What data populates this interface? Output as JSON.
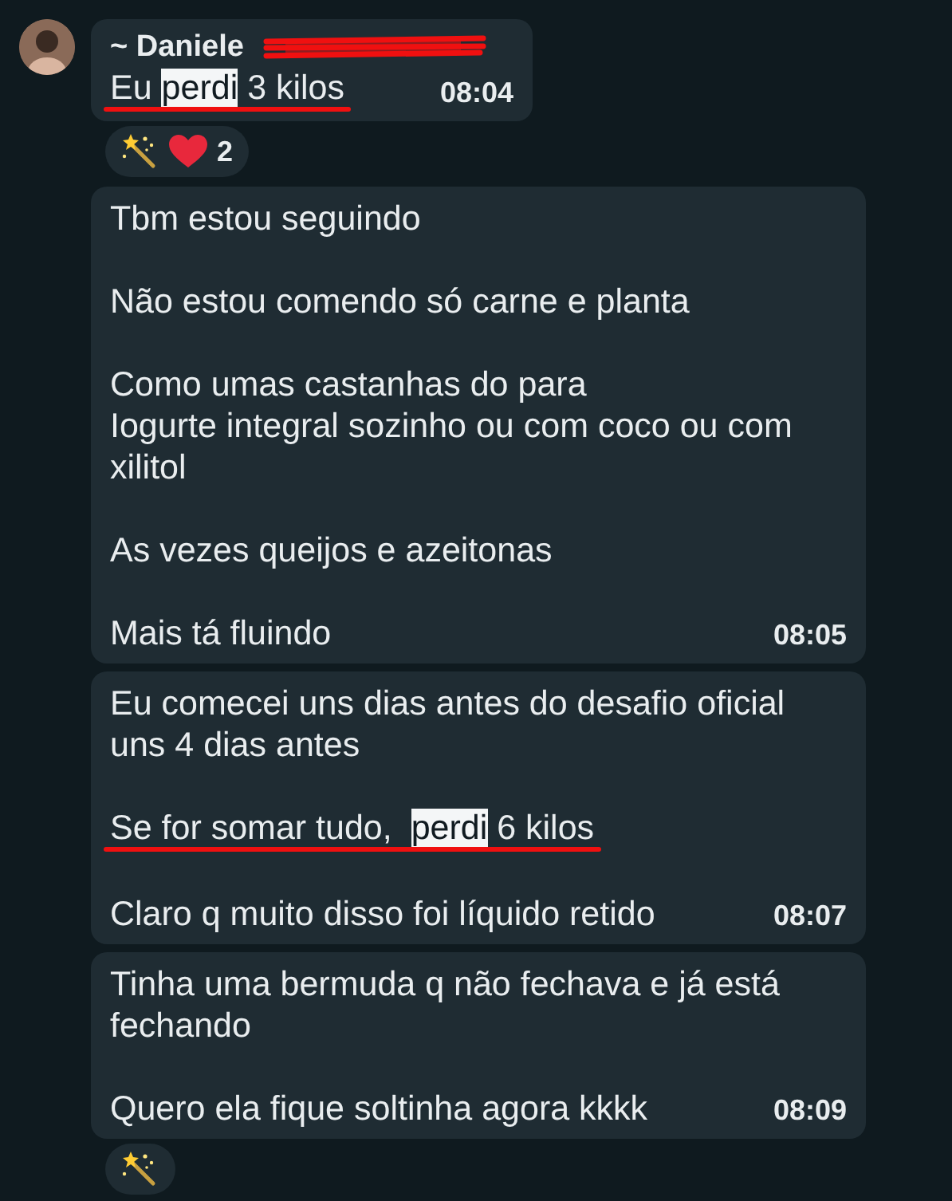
{
  "messages": [
    {
      "sender": {
        "name": "~ Daniele",
        "redacted": true
      },
      "avatar": true,
      "time": "08:04",
      "paragraphs": [
        [
          {
            "underlined": true,
            "segments": [
              {
                "text": "Eu ",
                "highlighted": false
              },
              {
                "text": "perdi",
                "highlighted": true
              },
              {
                "text": " 3 kilos",
                "highlighted": false
              }
            ]
          }
        ]
      ],
      "reaction": {
        "items": [
          {
            "kind": "wand"
          },
          {
            "kind": "heart"
          }
        ],
        "count": "2"
      }
    },
    {
      "time": "08:05",
      "paragraphs": [
        [
          {
            "underlined": false,
            "segments": [
              {
                "text": "Tbm estou seguindo",
                "highlighted": false
              }
            ]
          }
        ],
        [
          {
            "underlined": false,
            "segments": [
              {
                "text": "Não estou comendo só carne e planta",
                "highlighted": false
              }
            ]
          }
        ],
        [
          {
            "underlined": false,
            "segments": [
              {
                "text": "Como umas castanhas do para",
                "highlighted": false
              }
            ]
          },
          {
            "underlined": false,
            "segments": [
              {
                "text": "Iogurte integral sozinho ou com coco ou com xilitol",
                "highlighted": false
              }
            ]
          }
        ],
        [
          {
            "underlined": false,
            "segments": [
              {
                "text": "As vezes queijos e azeitonas",
                "highlighted": false
              }
            ]
          }
        ],
        [
          {
            "underlined": false,
            "segments": [
              {
                "text": "Mais tá fluindo",
                "highlighted": false
              }
            ]
          }
        ]
      ]
    },
    {
      "time": "08:07",
      "paragraphs": [
        [
          {
            "underlined": false,
            "segments": [
              {
                "text": "Eu comecei uns dias antes do desafio oficial uns 4 dias antes",
                "highlighted": false
              }
            ]
          }
        ],
        [
          {
            "underlined": true,
            "segments": [
              {
                "text": "Se for somar tudo,  ",
                "highlighted": false
              },
              {
                "text": "perdi",
                "highlighted": true
              },
              {
                "text": " 6 kilos",
                "highlighted": false
              }
            ]
          }
        ],
        [
          {
            "underlined": false,
            "segments": [
              {
                "text": "Claro q muito disso foi líquido retido",
                "highlighted": false
              }
            ]
          }
        ]
      ]
    },
    {
      "time": "08:09",
      "paragraphs": [
        [
          {
            "underlined": false,
            "segments": [
              {
                "text": "Tinha uma bermuda q não fechava e já está fechando",
                "highlighted": false
              }
            ]
          }
        ],
        [
          {
            "underlined": false,
            "segments": [
              {
                "text": "Quero ela fique soltinha agora kkkk",
                "highlighted": false
              }
            ]
          }
        ]
      ],
      "reaction": {
        "items": [
          {
            "kind": "wand"
          }
        ]
      }
    }
  ]
}
